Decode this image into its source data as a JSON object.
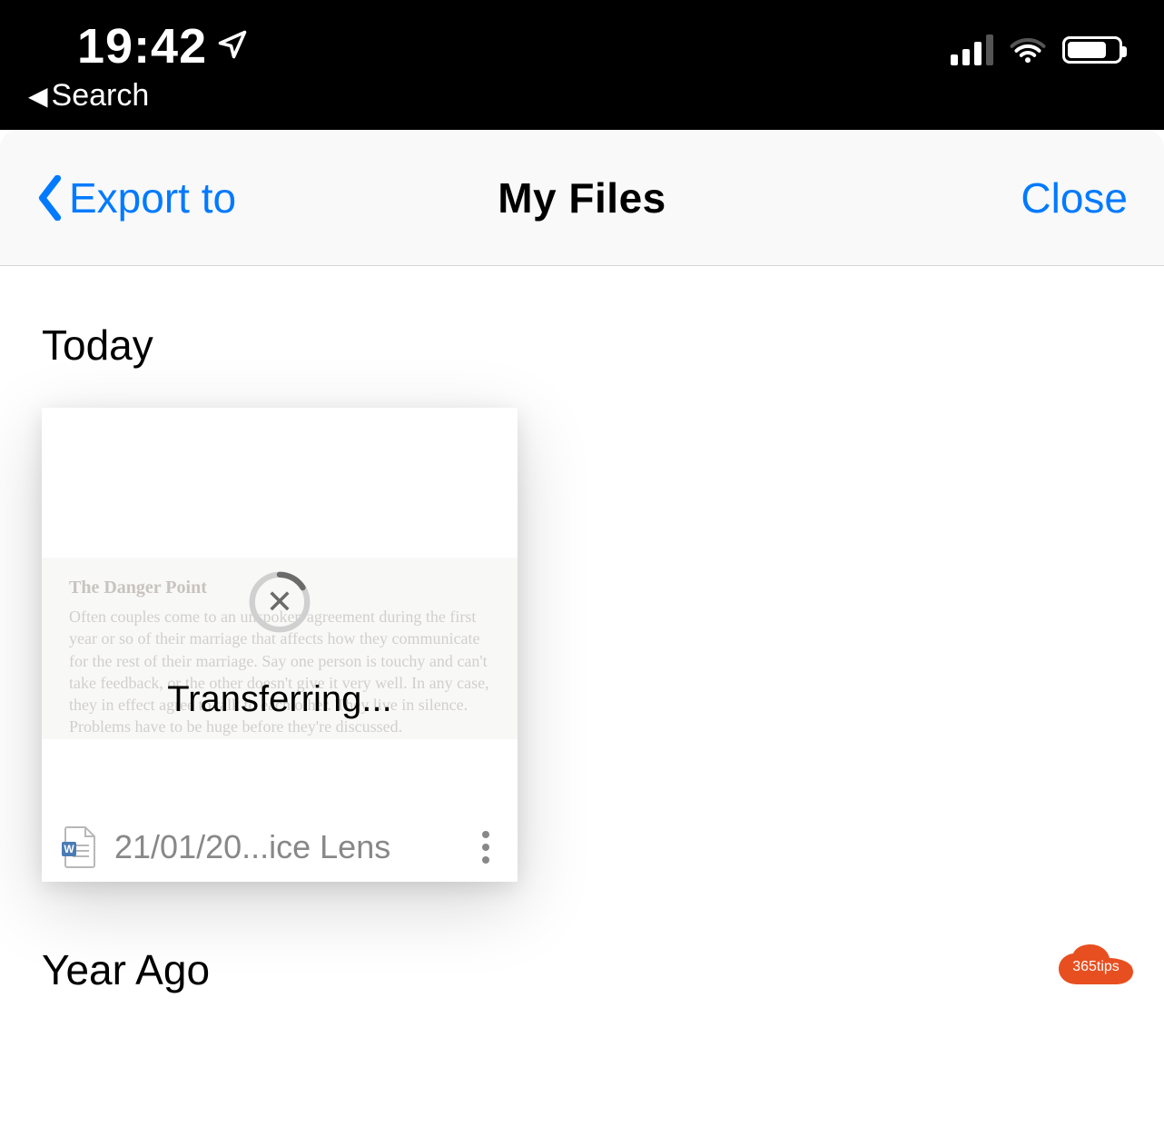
{
  "statusbar": {
    "time": "19:42",
    "back_label": "Search"
  },
  "navbar": {
    "back_label": "Export to",
    "title": "My Files",
    "close_label": "Close"
  },
  "sections": {
    "today_header": "Today",
    "year_ago_header": "Year Ago"
  },
  "file_card": {
    "preview_heading": "The Danger Point",
    "preview_body": "Often couples come to an unspoken agreement during the first year or so of their marriage that affects how they communicate for the rest of their marriage. Say one person is touchy and can't take feedback, or the other doesn't give it very well. In any case, they in effect agree to talk to each other. They live in silence. Problems have to be huge before they're discussed.",
    "transfer_label": "Transferring...",
    "file_name": "21/01/20...ice Lens"
  },
  "badge": {
    "text": "365tips"
  }
}
